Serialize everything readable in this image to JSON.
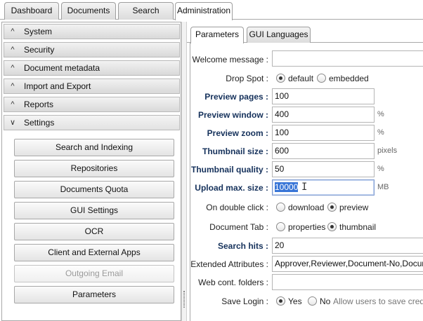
{
  "top_tabs": [
    {
      "label": "Dashboard"
    },
    {
      "label": "Documents"
    },
    {
      "label": "Search"
    },
    {
      "label": "Administration"
    }
  ],
  "active_top_tab": "Administration",
  "sidebar": {
    "sections": [
      {
        "label": "System",
        "icon": "chevron-up-icon"
      },
      {
        "label": "Security",
        "icon": "chevron-up-icon"
      },
      {
        "label": "Document metadata",
        "icon": "chevron-up-icon"
      },
      {
        "label": "Import and Export",
        "icon": "chevron-up-icon"
      },
      {
        "label": "Reports",
        "icon": "chevron-up-icon"
      },
      {
        "label": "Settings",
        "icon": "chevron-down-icon"
      }
    ],
    "settings_items": [
      {
        "label": "Search and Indexing",
        "enabled": true
      },
      {
        "label": "Repositories",
        "enabled": true
      },
      {
        "label": "Documents Quota",
        "enabled": true
      },
      {
        "label": "GUI Settings",
        "enabled": true
      },
      {
        "label": "OCR",
        "enabled": true
      },
      {
        "label": "Client and External Apps",
        "enabled": true
      },
      {
        "label": "Outgoing Email",
        "enabled": false
      },
      {
        "label": "Parameters",
        "enabled": true
      }
    ]
  },
  "sub_tabs": [
    {
      "label": "Parameters"
    },
    {
      "label": "GUI Languages"
    }
  ],
  "active_sub_tab": "Parameters",
  "form": {
    "welcome_message": {
      "label": "Welcome message :",
      "value": ""
    },
    "drop_spot": {
      "label": "Drop Spot :",
      "options": [
        "default",
        "embedded"
      ],
      "selected": "default"
    },
    "preview_pages": {
      "label": "Preview pages :",
      "value": "100"
    },
    "preview_window": {
      "label": "Preview window :",
      "value": "400",
      "unit": "%"
    },
    "preview_zoom": {
      "label": "Preview zoom :",
      "value": "100",
      "unit": "%"
    },
    "thumbnail_size": {
      "label": "Thumbnail size :",
      "value": "600",
      "unit": "pixels"
    },
    "thumbnail_quality": {
      "label": "Thumbnail quality :",
      "value": "50",
      "unit": "%"
    },
    "upload_max_size": {
      "label": "Upload max. size :",
      "value": "10000",
      "unit": "MB"
    },
    "on_double_click": {
      "label": "On double click :",
      "options": [
        "download",
        "preview"
      ],
      "selected": "preview"
    },
    "document_tab": {
      "label": "Document Tab :",
      "options": [
        "properties",
        "thumbnail"
      ],
      "selected": "thumbnail"
    },
    "search_hits": {
      "label": "Search hits :",
      "value": "20"
    },
    "extended_attributes": {
      "label": "Extended Attributes :",
      "value": "Approver,Reviewer,Document-No,Document"
    },
    "web_cont_folders": {
      "label": "Web cont. folders :",
      "value": ""
    },
    "save_login": {
      "label": "Save Login :",
      "options": [
        "Yes",
        "No"
      ],
      "selected": "Yes",
      "hint": "Allow users to save crede"
    }
  },
  "colors": {
    "bold_label": "#15315b",
    "selection": "#3875d7",
    "focus_border": "#7e9bd0"
  }
}
